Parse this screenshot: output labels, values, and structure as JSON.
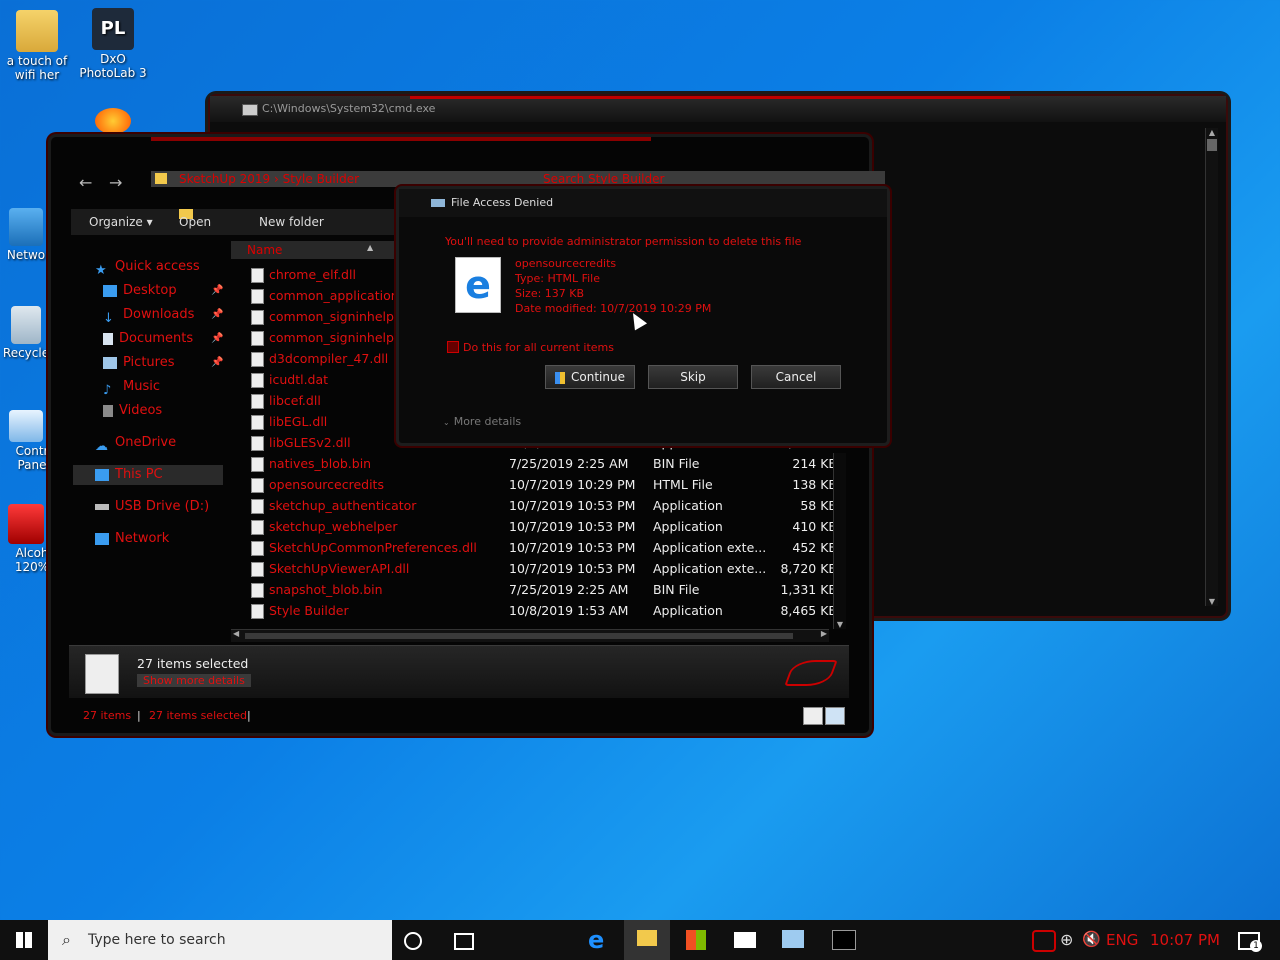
{
  "desktop": {
    "icons": [
      {
        "label": "a touch of wifi her"
      },
      {
        "label": "DxO PhotoLab 3"
      },
      {
        "label": "Netwo"
      },
      {
        "label": "Recycle"
      },
      {
        "label": "Contr Pane"
      },
      {
        "label": "Alcoh 120%"
      }
    ]
  },
  "cmd": {
    "title": "C:\\Windows\\System32\\cmd.exe"
  },
  "explorer": {
    "address_left": "SketchUp 2019  ›  Style Builder",
    "address_right": "Search Style Builder",
    "toolbar": {
      "organize": "Organize ▾",
      "open": "Open",
      "new_folder": "New folder"
    },
    "column_name": "Name",
    "nav": [
      {
        "label": "Quick access",
        "icon": "star-icon"
      },
      {
        "label": "Desktop",
        "icon": "desktop-icon"
      },
      {
        "label": "Downloads",
        "icon": "download-icon"
      },
      {
        "label": "Documents",
        "icon": "documents-icon"
      },
      {
        "label": "Pictures",
        "icon": "pictures-icon"
      },
      {
        "label": "Music",
        "icon": "music-icon"
      },
      {
        "label": "Videos",
        "icon": "videos-icon"
      },
      {
        "label": "OneDrive",
        "icon": "cloud-icon"
      },
      {
        "label": "This PC",
        "icon": "computer-icon"
      },
      {
        "label": "USB Drive (D:)",
        "icon": "drive-icon"
      },
      {
        "label": "Network",
        "icon": "network-icon"
      }
    ],
    "files": [
      {
        "name": "chrome_elf.dll",
        "date": "",
        "type": "",
        "size": ""
      },
      {
        "name": "common_application.dll",
        "date": "",
        "type": "",
        "size": ""
      },
      {
        "name": "common_signinhelper.dll",
        "date": "",
        "type": "",
        "size": ""
      },
      {
        "name": "common_signinhelper.exe",
        "date": "",
        "type": "",
        "size": ""
      },
      {
        "name": "d3dcompiler_47.dll",
        "date": "",
        "type": "",
        "size": ""
      },
      {
        "name": "icudtl.dat",
        "date": "",
        "type": "",
        "size": ""
      },
      {
        "name": "libcef.dll",
        "date": "",
        "type": "",
        "size": ""
      },
      {
        "name": "libEGL.dll",
        "date": "",
        "type": "",
        "size": ""
      },
      {
        "name": "libGLESv2.dll",
        "date": "10/7/2019 10:53 PM",
        "type": "Application exte...",
        "size": "4,332 KB"
      },
      {
        "name": "natives_blob.bin",
        "date": "7/25/2019 2:25 AM",
        "type": "BIN File",
        "size": "214 KB"
      },
      {
        "name": "opensourcecredits",
        "date": "10/7/2019 10:29 PM",
        "type": "HTML File",
        "size": "138 KB"
      },
      {
        "name": "sketchup_authenticator",
        "date": "10/7/2019 10:53 PM",
        "type": "Application",
        "size": "58 KB"
      },
      {
        "name": "sketchup_webhelper",
        "date": "10/7/2019 10:53 PM",
        "type": "Application",
        "size": "410 KB"
      },
      {
        "name": "SketchUpCommonPreferences.dll",
        "date": "10/7/2019 10:53 PM",
        "type": "Application exte...",
        "size": "452 KB"
      },
      {
        "name": "SketchUpViewerAPI.dll",
        "date": "10/7/2019 10:53 PM",
        "type": "Application exte...",
        "size": "8,720 KB"
      },
      {
        "name": "snapshot_blob.bin",
        "date": "7/25/2019 2:25 AM",
        "type": "BIN File",
        "size": "1,331 KB"
      },
      {
        "name": "Style Builder",
        "date": "10/8/2019 1:53 AM",
        "type": "Application",
        "size": "8,465 KB"
      }
    ],
    "details_title": "27 items selected",
    "details_link": "Show more details",
    "status_count": "27 items",
    "status_selected": "27 items selected"
  },
  "dialog": {
    "title": "File Access Denied",
    "message": "You'll need to provide administrator permission to delete this file",
    "file_name": "opensourcecredits",
    "file_type": "Type: HTML File",
    "file_size": "Size: 137 KB",
    "file_date": "Date modified: 10/7/2019 10:29 PM",
    "checkbox_label": "Do this for all current items",
    "continue": "Continue",
    "skip": "Skip",
    "cancel": "Cancel",
    "more_details": "More details"
  },
  "taskbar": {
    "search_placeholder": "Type here to search",
    "language": "ENG",
    "time": "10:07 PM",
    "notification_count": "1"
  }
}
